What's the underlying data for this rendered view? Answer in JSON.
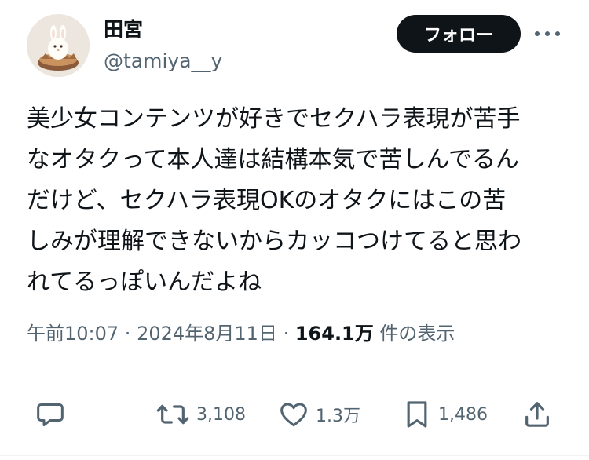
{
  "author": {
    "display_name": "田宮",
    "handle": "@tamiya__y"
  },
  "follow_button": {
    "label": "フォロー"
  },
  "tweet": {
    "lines": [
      "美少女コンテンツが好きでセクハラ表現が苦手",
      "なオタクって本人達は結構本気で苦しんでるん",
      "だけど、セクハラ表現OKのオタクにはこの苦",
      "しみが理解できないからカッコつけてると思わ",
      "れてるっぽいんだよね"
    ]
  },
  "meta": {
    "time": "午前10:07",
    "separator": " · ",
    "date": "2024年8月11日",
    "views_count": "164.1万",
    "views_label": "件の表示"
  },
  "actions": {
    "reply_icon": "speech-bubble-icon",
    "retweet_count": "3,108",
    "like_count": "1.3万",
    "bookmark_count": "1,486",
    "share_icon": "share-arrow-icon"
  },
  "colors": {
    "text_primary": "#0f1419",
    "text_secondary": "#536471",
    "button_bg": "#0f1419",
    "button_text": "#ffffff",
    "divider": "#e6e9eb"
  }
}
